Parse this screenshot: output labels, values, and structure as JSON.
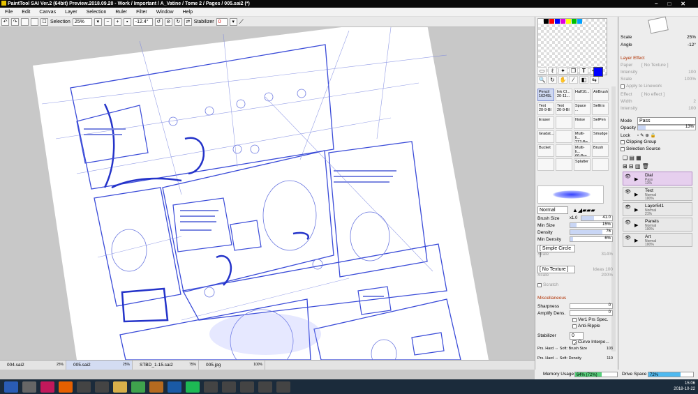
{
  "window": {
    "title": "PaintTool SAI Ver.2 (64bit) Preview.2018.09.20 - Work / Important / A_Vatine / Tome 2 / Pages / 005.sai2 (*)"
  },
  "menu": [
    "File",
    "Edit",
    "Canvas",
    "Layer",
    "Selection",
    "Ruler",
    "Filter",
    "Window",
    "Help"
  ],
  "toolbar": {
    "selection_label": "Selection",
    "zoom": "25%",
    "angle": "-12.4°",
    "stabilizer_label": "Stabilizer",
    "stabilizer_value": "0"
  },
  "navigator": {
    "scale_label": "Scale",
    "scale_value": "25%",
    "angle_label": "Angle",
    "angle_value": "-12°"
  },
  "layer_effect": {
    "heading": "Layer Effect",
    "paper_label": "Paper",
    "paper_value": "[ No Texture ]",
    "intensity_label": "Intensity",
    "intensity_value": "100",
    "scale_label": "Scale",
    "scale_value": "100%",
    "apply_label": "Apply to Linework",
    "effect_label": "Effect",
    "effect_value": "[ No effect ]",
    "width_label": "Width",
    "width_value": "2",
    "intensity2_label": "Intensity",
    "intensity2_value": "100"
  },
  "layer_props": {
    "mode_label": "Mode",
    "mode_value": "Pass",
    "opacity_label": "Opacity",
    "opacity_value": "13%",
    "lock_label": "Lock",
    "clipping_label": "Clipping Group",
    "selsource_label": "Selection Source"
  },
  "layers": [
    {
      "name": "Dial",
      "mode": "Pass",
      "opacity": "13%",
      "selected": true
    },
    {
      "name": "Text",
      "mode": "Normal",
      "opacity": "100%",
      "selected": false
    },
    {
      "name": "Layer541",
      "mode": "Normal",
      "opacity": "21%",
      "selected": false
    },
    {
      "name": "Panels",
      "mode": "Normal",
      "opacity": "100%",
      "selected": false
    },
    {
      "name": "Art",
      "mode": "Normal",
      "opacity": "100%",
      "selected": false
    }
  ],
  "brushes": [
    {
      "name": "Pencil",
      "sub": "16245L",
      "selected": true
    },
    {
      "name": "Ink Cl...",
      "sub": "20-11...",
      "selected": false
    },
    {
      "name": "Half10...",
      "sub": "",
      "selected": false
    },
    {
      "name": "AirBrush",
      "sub": "",
      "selected": false
    },
    {
      "name": "Text",
      "sub": "20-9-Bl",
      "selected": false
    },
    {
      "name": "Text",
      "sub": "20-9-Bl",
      "selected": false
    },
    {
      "name": "Space ...",
      "sub": "",
      "selected": false
    },
    {
      "name": "SelErs",
      "sub": "",
      "selected": false
    },
    {
      "name": "Eraser",
      "sub": "",
      "selected": false
    },
    {
      "name": "",
      "sub": "",
      "selected": false
    },
    {
      "name": "Noise",
      "sub": "",
      "selected": false
    },
    {
      "name": "SelPen",
      "sub": "",
      "selected": false
    },
    {
      "name": "Gradat...",
      "sub": "",
      "selected": false
    },
    {
      "name": "",
      "sub": "",
      "selected": false
    },
    {
      "name": "Multi-li...",
      "sub": "212-Bg",
      "selected": false
    },
    {
      "name": "Smudge",
      "sub": "",
      "selected": false
    },
    {
      "name": "Bucket",
      "sub": "",
      "selected": false
    },
    {
      "name": "",
      "sub": "",
      "selected": false
    },
    {
      "name": "Multi-li...",
      "sub": "66-Brg",
      "selected": false
    },
    {
      "name": "Brush",
      "sub": "",
      "selected": false
    },
    {
      "name": "",
      "sub": "",
      "selected": false
    },
    {
      "name": "",
      "sub": "",
      "selected": false
    },
    {
      "name": "Splatter",
      "sub": "",
      "selected": false
    },
    {
      "name": "",
      "sub": "",
      "selected": false
    }
  ],
  "brush_settings": {
    "blend_mode": "Normal",
    "size_label": "Brush Size",
    "size_mult": "x1.0",
    "size_value": "41.0",
    "minsize_label": "Min Size",
    "minsize_value": "15%",
    "density_label": "Density",
    "density_value": "76",
    "mindensity_label": "Min Density",
    "mindensity_value": "6%",
    "shape_value": "[ Simple Circle ]",
    "shape_scale_label": "Scale",
    "shape_scale_value": "314%",
    "texture_value": "[ No Texture ]",
    "texture_scale_label": "Scale",
    "texture_scale_value": "200%",
    "texture_extra": "Ideas 100",
    "scratch_label": "Scratch",
    "misc_heading": "Miscellaneous",
    "sharpness_label": "Sharpness",
    "sharpness_value": "0",
    "amplify_label": "Amplify Dens.",
    "amplify_value": "0",
    "ver1_label": "Ver1 Prs Spec.",
    "antiripple_label": "Anti-Ripple",
    "stabilizer_label": "Stabilizer",
    "stabilizer_value": "0",
    "curve_label": "Curve Interpo...",
    "prs1_label": "Prs. Hard ⇔ Soft: Brush Size",
    "prs1_value": "103",
    "prs2_label": "Prs. Hard ⇔ Soft: Density",
    "prs2_value": "110"
  },
  "file_tabs": [
    {
      "name": "004.sai2",
      "zoom": "25%",
      "selected": false
    },
    {
      "name": "005.sai2",
      "zoom": "25%",
      "selected": true
    },
    {
      "name": "STBD_1-15.sai2",
      "zoom": "75%",
      "selected": false
    },
    {
      "name": "005.jpg",
      "zoom": "100%",
      "selected": false
    }
  ],
  "status": {
    "memory_label": "Memory Usage",
    "memory_value": "64% (72%)",
    "memory_fraction": 0.64,
    "drive_label": "Drive Space",
    "drive_value": "72%",
    "drive_fraction": 0.72
  },
  "taskbar": {
    "icons": [
      "windows-icon",
      "file-icon",
      "indesign-icon",
      "firefox-icon",
      "app-icon",
      "app-icon",
      "folder-icon",
      "chrome-icon",
      "bridge-icon",
      "photoshop-icon",
      "spotify-icon",
      "app-icon",
      "app-icon",
      "app-icon",
      "app-icon",
      "app-icon"
    ],
    "time": "15:06",
    "date": "2018-10-22"
  },
  "colors": {
    "accent": "#0000ff",
    "sketch": "#3a4bd8",
    "selected_layer": "#e6cfee"
  }
}
